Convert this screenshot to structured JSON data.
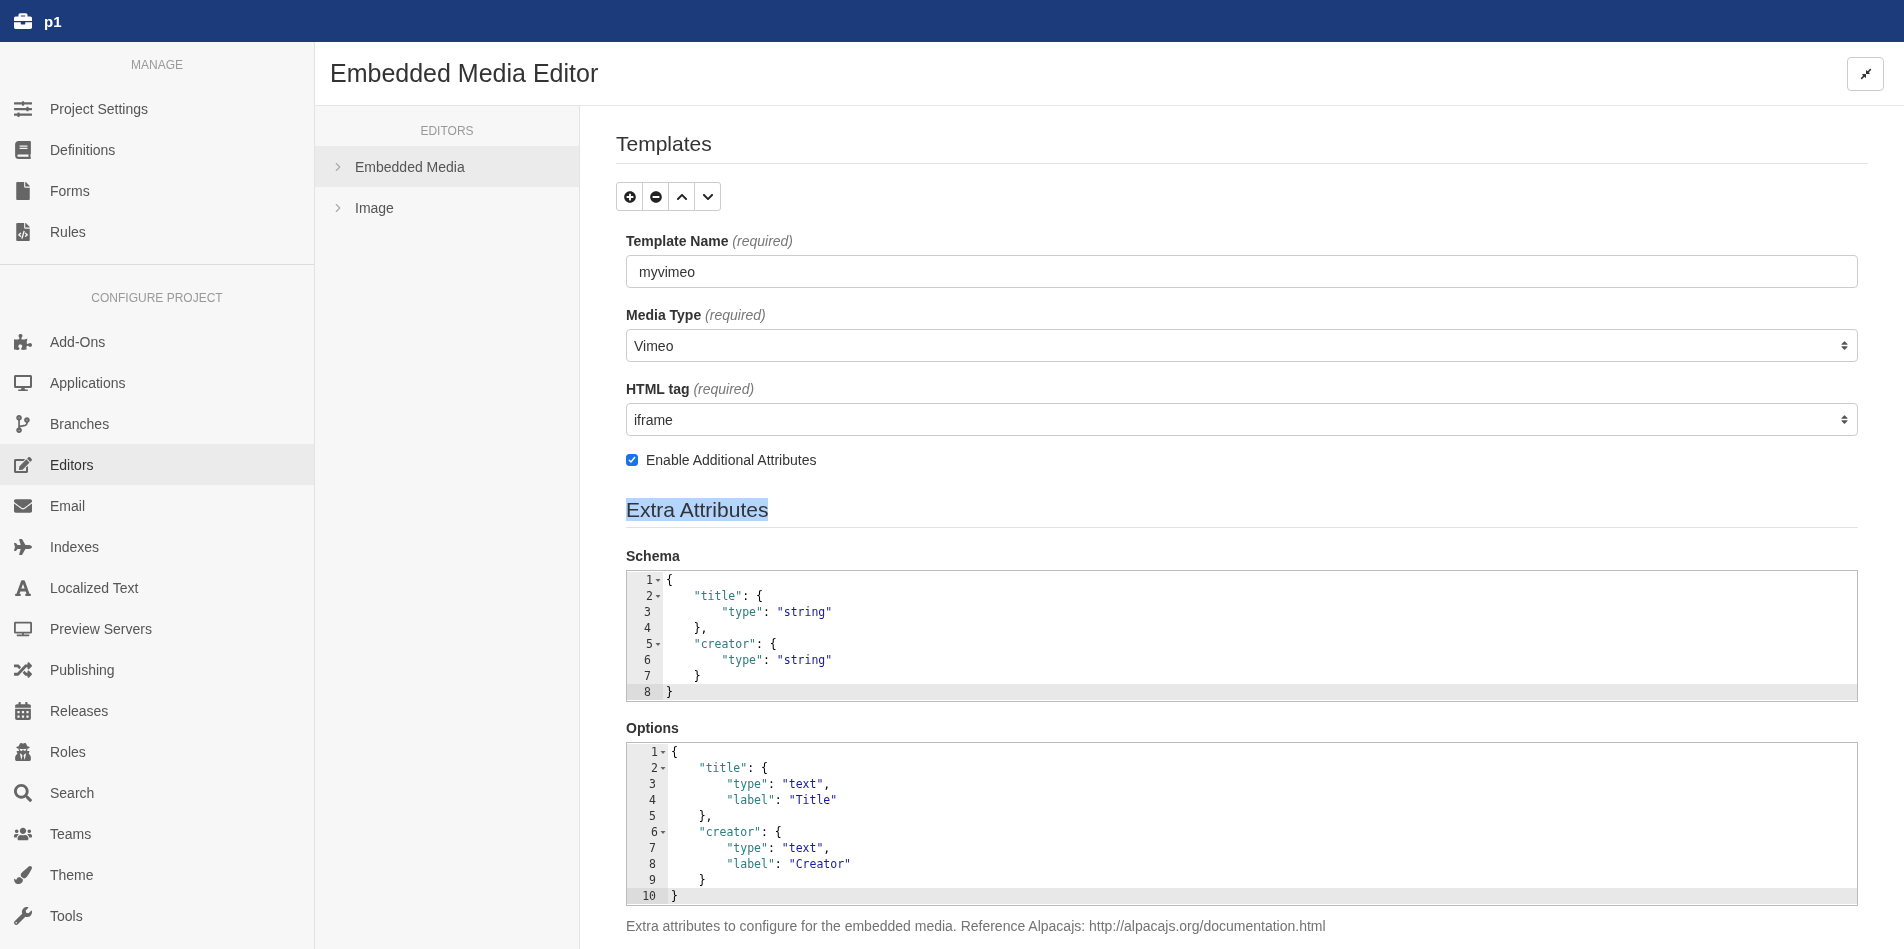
{
  "top_bar": {
    "project": "p1"
  },
  "sidebar": {
    "sections": [
      {
        "heading": "MANAGE",
        "items": [
          {
            "label": "Project Settings",
            "selected": false
          },
          {
            "label": "Definitions",
            "selected": false
          },
          {
            "label": "Forms",
            "selected": false
          },
          {
            "label": "Rules",
            "selected": false
          }
        ]
      },
      {
        "heading": "CONFIGURE PROJECT",
        "items": [
          {
            "label": "Add-Ons",
            "selected": false
          },
          {
            "label": "Applications",
            "selected": false
          },
          {
            "label": "Branches",
            "selected": false
          },
          {
            "label": "Editors",
            "selected": true
          },
          {
            "label": "Email",
            "selected": false
          },
          {
            "label": "Indexes",
            "selected": false
          },
          {
            "label": "Localized Text",
            "selected": false
          },
          {
            "label": "Preview Servers",
            "selected": false
          },
          {
            "label": "Publishing",
            "selected": false
          },
          {
            "label": "Releases",
            "selected": false
          },
          {
            "label": "Roles",
            "selected": false
          },
          {
            "label": "Search",
            "selected": false
          },
          {
            "label": "Teams",
            "selected": false
          },
          {
            "label": "Theme",
            "selected": false
          },
          {
            "label": "Tools",
            "selected": false
          }
        ]
      }
    ]
  },
  "page": {
    "title": "Embedded Media Editor"
  },
  "editors": {
    "heading": "EDITORS",
    "items": [
      {
        "label": "Embedded Media",
        "selected": true
      },
      {
        "label": "Image",
        "selected": false
      }
    ]
  },
  "form": {
    "heading": "Templates",
    "fields": [
      {
        "kind": "text",
        "label": "Template Name",
        "note": "(required)",
        "value": "myvimeo"
      },
      {
        "kind": "select",
        "label": "Media Type",
        "note": "(required)",
        "value": "Vimeo"
      },
      {
        "kind": "select",
        "label": "HTML tag",
        "note": "(required)",
        "value": "iframe"
      }
    ],
    "checkbox": {
      "label": "Enable Additional Attributes",
      "checked": true
    },
    "extra": {
      "heading": "Extra Attributes",
      "text_selected": true,
      "editors": [
        {
          "label": "Schema",
          "lines": [
            {
              "number": "1",
              "text": "{",
              "foldable": true,
              "active": false
            },
            {
              "number": "2",
              "text": "    \"title\": {",
              "foldable": true,
              "active": false
            },
            {
              "number": "3",
              "text": "        \"type\": \"string\"",
              "foldable": false,
              "active": false
            },
            {
              "number": "4",
              "text": "    },",
              "foldable": false,
              "active": false
            },
            {
              "number": "5",
              "text": "    \"creator\": {",
              "foldable": true,
              "active": false
            },
            {
              "number": "6",
              "text": "        \"type\": \"string\"",
              "foldable": false,
              "active": false
            },
            {
              "number": "7",
              "text": "    }",
              "foldable": false,
              "active": false
            },
            {
              "number": "8",
              "text": "}",
              "foldable": false,
              "active": true
            }
          ]
        },
        {
          "label": "Options",
          "lines": [
            {
              "number": "1",
              "text": "{",
              "foldable": true,
              "active": false
            },
            {
              "number": "2",
              "text": "    \"title\": {",
              "foldable": true,
              "active": false
            },
            {
              "number": "3",
              "text": "        \"type\": \"text\",",
              "foldable": false,
              "active": false
            },
            {
              "number": "4",
              "text": "        \"label\": \"Title\"",
              "foldable": false,
              "active": false
            },
            {
              "number": "5",
              "text": "    },",
              "foldable": false,
              "active": false
            },
            {
              "number": "6",
              "text": "    \"creator\": {",
              "foldable": true,
              "active": false
            },
            {
              "number": "7",
              "text": "        \"type\": \"text\",",
              "foldable": false,
              "active": false
            },
            {
              "number": "8",
              "text": "        \"label\": \"Creator\"",
              "foldable": false,
              "active": false
            },
            {
              "number": "9",
              "text": "    }",
              "foldable": false,
              "active": false
            },
            {
              "number": "10",
              "text": "}",
              "foldable": false,
              "active": true
            }
          ]
        }
      ],
      "help": "Extra attributes to configure for the embedded media. Reference Alpacajs: http://alpacajs.org/documentation.html"
    }
  }
}
